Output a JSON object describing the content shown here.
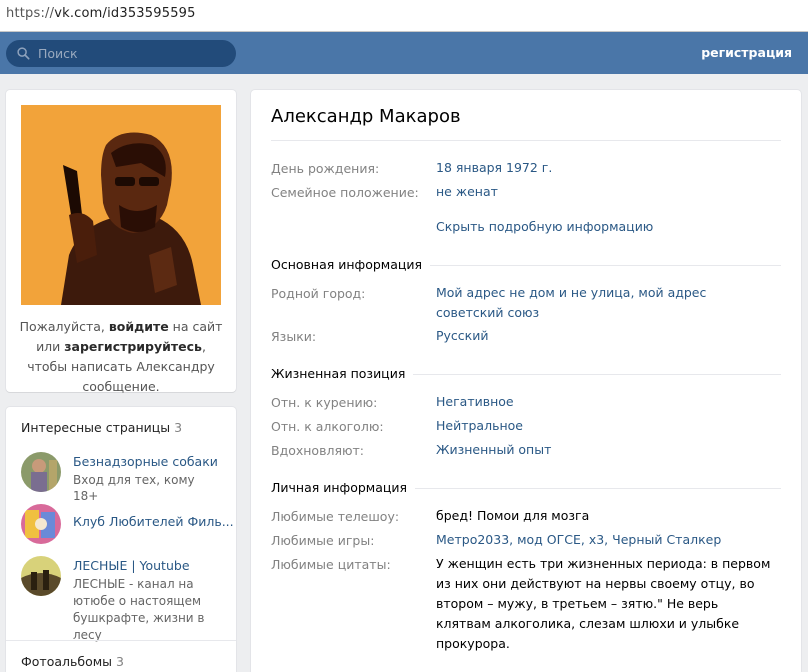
{
  "browser": {
    "url_prefix": "https://",
    "url_host": "vk.com/id353595595"
  },
  "header": {
    "search_placeholder": "Поиск",
    "register_label": "регистрация"
  },
  "colors": {
    "header": "#4a76a8",
    "link": "#2a5885",
    "label": "#828282",
    "background": "#edeef0"
  },
  "left": {
    "login_prompt": {
      "before": "Пожалуйста, ",
      "login": "войдите",
      "middle": " на сайт или ",
      "register": "зарегистрируйтесь",
      "after": ", чтобы написать Александру сообщение."
    },
    "pages_title": "Интересные страницы",
    "pages_count": "3",
    "pages": [
      {
        "name": "Безнадзорные собаки",
        "desc": "Вход для тех, кому 18+"
      },
      {
        "name": "Клуб Любителей Филь...",
        "desc": ""
      },
      {
        "name": "ЛЕСНЫЕ | Youtube",
        "desc": "ЛЕСНЫЕ - канал на ютюбе о настоящем бушкрафте, жизни в лесу"
      }
    ],
    "albums_title": "Фотоальбомы",
    "albums_count": "3"
  },
  "profile": {
    "name": "Александр Макаров",
    "birthday_label": "День рождения:",
    "birthday": "18 января 1972 г.",
    "family_label": "Семейное положение:",
    "family": "не женат",
    "hide_details": "Скрыть подробную информацию",
    "main_section": "Основная информация",
    "hometown_label": "Родной город:",
    "hometown": "Мой адрес не дом и не улица, мой адрес советский союз",
    "languages_label": "Языки:",
    "languages": "Русский",
    "position_section": "Жизненная позиция",
    "smoking_label": "Отн. к курению:",
    "smoking": "Негативное",
    "alcohol_label": "Отн. к алкоголю:",
    "alcohol": "Нейтральное",
    "inspire_label": "Вдохновляют:",
    "inspire": "Жизненный опыт",
    "personal_section": "Личная информация",
    "tv_label": "Любимые телешоу:",
    "tv": "бред! Помои для мозга",
    "games_label": "Любимые игры:",
    "games": "Метро2033, мод ОГСЕ, х3, Черный Сталкер",
    "quotes_label": "Любимые цитаты:",
    "quotes": "У женщин есть три жизненных периода: в первом из них они действуют на нервы своему отцу, во втором – мужу, в третьем – зятю.\" Не верь клятвам алкоголика, слезам шлюхи и улыбке прокурора."
  }
}
